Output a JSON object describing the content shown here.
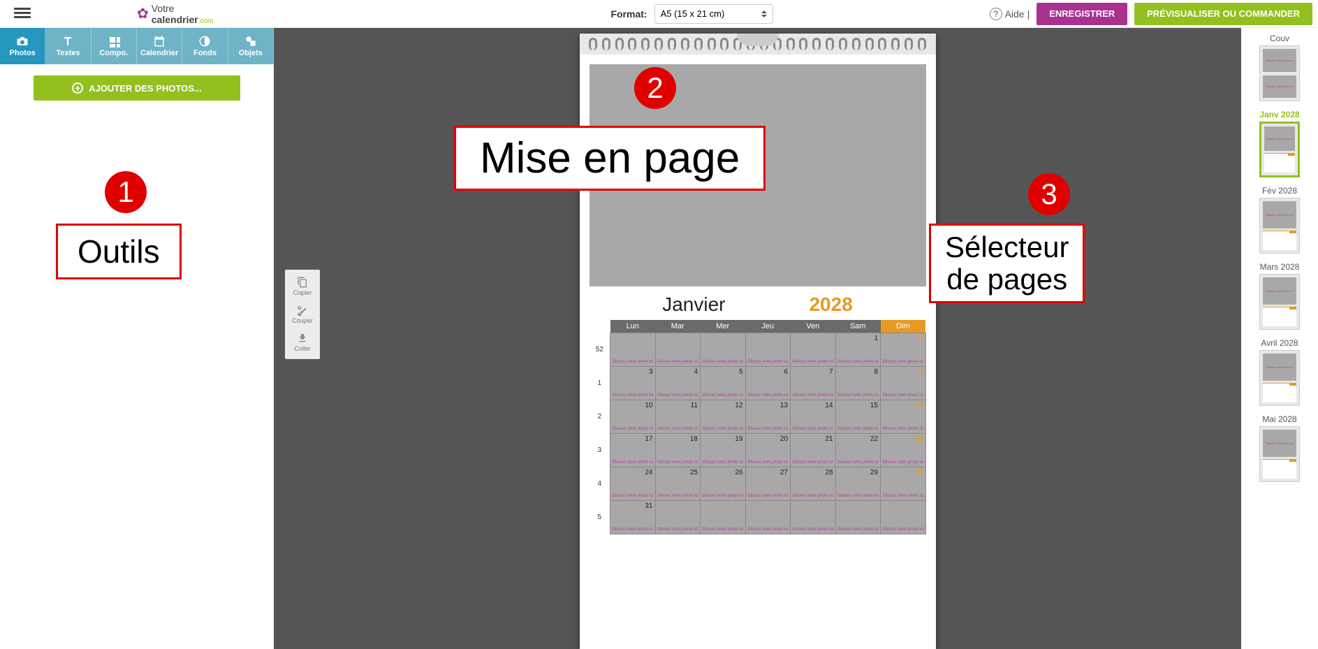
{
  "header": {
    "logo_top": "Votre",
    "logo_bot": "calendrier",
    "logo_com": ".com",
    "format_label": "Format:",
    "format_value": "A5 (15 x 21 cm)",
    "aide": "Aide",
    "save": "ENREGISTRER",
    "preview": "PRÉVISUALISER OU COMMANDER"
  },
  "tools": [
    "Photos",
    "Textes",
    "Compo.",
    "Calendrier",
    "Fonds",
    "Objets"
  ],
  "add_photos": "AJOUTER DES PHOTOS...",
  "clipboard": {
    "copy": "Copier",
    "cut": "Couper",
    "paste": "Coller"
  },
  "annotations": {
    "n1": "1",
    "l1": "Outils",
    "n2": "2",
    "l2": "Mise en page",
    "n3": "3",
    "l3": "Sélecteur\nde pages"
  },
  "calendar": {
    "month": "Janvier",
    "year": "2028",
    "drop_text": "Glissez votre photo ici",
    "days": [
      "Lun",
      "Mar",
      "Mer",
      "Jeu",
      "Ven",
      "Sam",
      "Dim"
    ],
    "weeks": [
      "52",
      "1",
      "2",
      "3",
      "4",
      "5"
    ],
    "grid": [
      [
        null,
        null,
        null,
        null,
        null,
        "1",
        "2"
      ],
      [
        "3",
        "4",
        "5",
        "6",
        "7",
        "8",
        "9"
      ],
      [
        "10",
        "11",
        "12",
        "13",
        "14",
        "15",
        "16"
      ],
      [
        "17",
        "18",
        "19",
        "20",
        "21",
        "22",
        "23"
      ],
      [
        "24",
        "25",
        "26",
        "27",
        "28",
        "29",
        "30"
      ],
      [
        "31",
        null,
        null,
        null,
        null,
        null,
        null
      ]
    ]
  },
  "thumbs": [
    {
      "label": "Couv",
      "type": "couv"
    },
    {
      "label": "Janv 2028",
      "active": true
    },
    {
      "label": "Fév 2028"
    },
    {
      "label": "Mars 2028"
    },
    {
      "label": "Avril 2028"
    },
    {
      "label": "Mai 2028"
    }
  ]
}
